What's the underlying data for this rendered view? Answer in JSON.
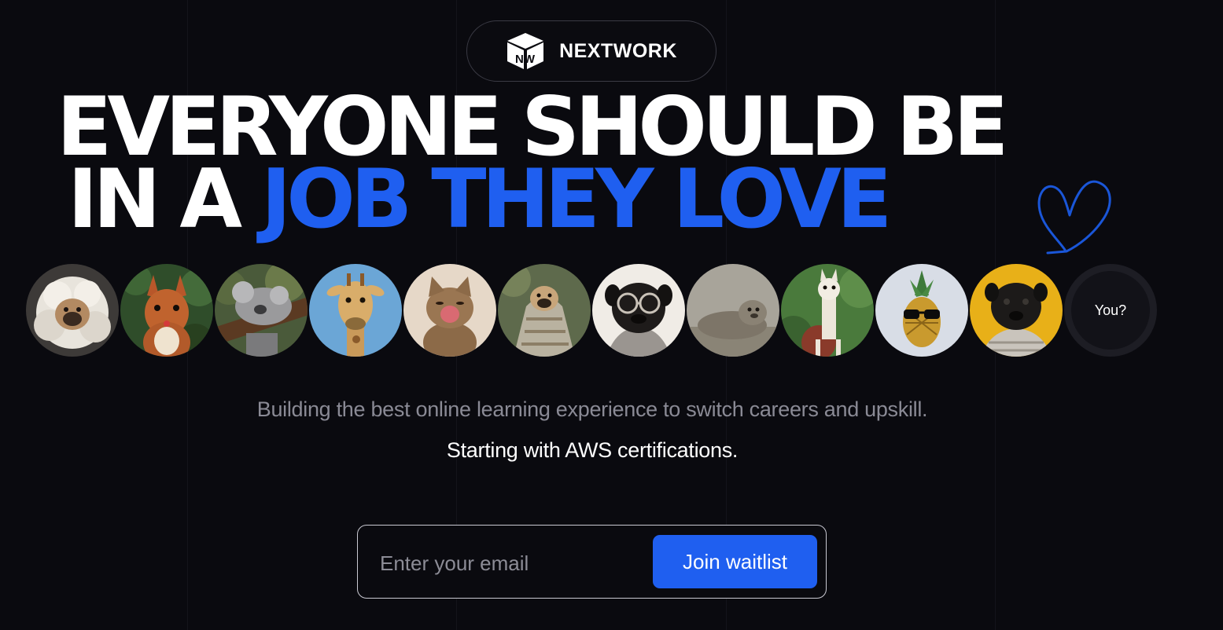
{
  "brand": {
    "name": "NEXTWORK",
    "logo_letters": "NW"
  },
  "hero": {
    "line1": "EVERYONE SHOULD BE",
    "line2_prefix": "IN A",
    "line2_accent": "JOB THEY LOVE"
  },
  "avatars": {
    "items": [
      {
        "name": "pug-in-fur-hood"
      },
      {
        "name": "red-squirrel"
      },
      {
        "name": "sleeping-koala"
      },
      {
        "name": "giraffe"
      },
      {
        "name": "yawning-kitten"
      },
      {
        "name": "pug-in-blanket"
      },
      {
        "name": "pug-with-glasses"
      },
      {
        "name": "seal"
      },
      {
        "name": "llama"
      },
      {
        "name": "pineapple-with-sunglasses"
      },
      {
        "name": "pug-in-sweater"
      }
    ],
    "you_label": "You?"
  },
  "tagline": {
    "primary": "Building the best online learning experience to switch careers and upskill.",
    "secondary": "Starting with AWS certifications."
  },
  "waitlist": {
    "email_placeholder": "Enter your email",
    "email_value": "",
    "button_label": "Join waitlist"
  },
  "colors": {
    "background": "#0a0a0f",
    "accent": "#1f5ff0",
    "muted_text": "#8a8a95"
  }
}
